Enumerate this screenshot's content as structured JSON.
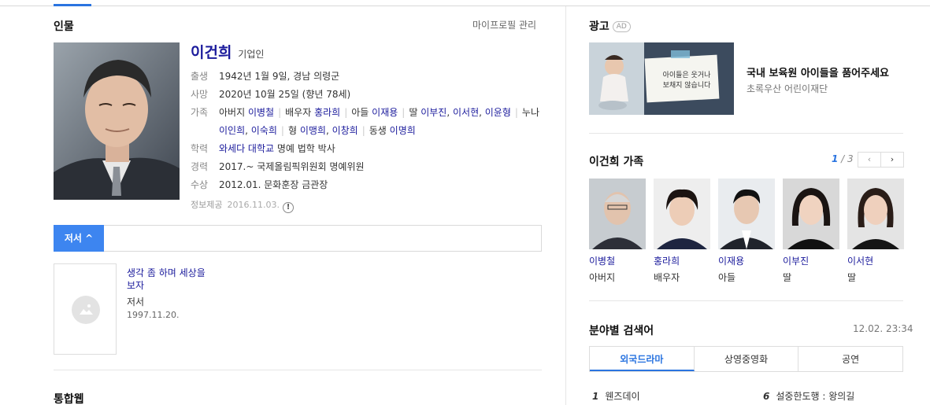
{
  "person": {
    "section_title": "인물",
    "manage_link": "마이프로필 관리",
    "name": "이건희",
    "job": "기업인",
    "birth": {
      "label": "출생",
      "value": "1942년 1월 9일, 경남 의령군"
    },
    "death": {
      "label": "사망",
      "value": "2020년 10월 25일 (향년 78세)"
    },
    "family": {
      "label": "가족",
      "father_rel": "아버지",
      "father": "이병철",
      "spouse_rel": "배우자",
      "spouse": "홍라희",
      "son_rel": "아들",
      "son": "이재용",
      "daughter_rel": "딸",
      "daughter1": "이부진",
      "daughter2": "이서현",
      "daughter3": "이윤형",
      "sister_rel": "누나",
      "sister1": "이인희",
      "sister2": "이숙희",
      "brother_rel": "형",
      "brother1": "이맹희",
      "brother2": "이창희",
      "younger_rel": "동생",
      "younger": "이명희"
    },
    "education": {
      "label": "학력",
      "school": "와세다 대학교",
      "detail": " 명예 법학 박사"
    },
    "career": {
      "label": "경력",
      "value": "2017.~ 국제올림픽위원회 명예위원"
    },
    "award": {
      "label": "수상",
      "value": "2012.01. 문화훈장 금관장"
    },
    "source_label": "정보제공",
    "source_date": "2016.11.03.",
    "excl": "!"
  },
  "works": {
    "tab_label": "저서 ^",
    "book_title": "생각 좀 하며 세상을 보자",
    "book_type": "저서",
    "book_date": "1997.11.20."
  },
  "next_section": "통합웹",
  "ad": {
    "section_title": "광고",
    "badge": "AD",
    "title": "국내 보육원 아이들을 품어주세요",
    "sponsor": "초록우산 어린이재단",
    "sign_line1": "아이들은 웃거나",
    "sign_line2": "보채지 않습니다"
  },
  "family_panel": {
    "title": "이건희 가족",
    "page_current": "1",
    "page_total": " / 3",
    "prev": "‹",
    "next": "›",
    "members": [
      {
        "name": "이병철",
        "relation": "아버지"
      },
      {
        "name": "홍라희",
        "relation": "배우자"
      },
      {
        "name": "이재용",
        "relation": "아들"
      },
      {
        "name": "이부진",
        "relation": "딸"
      },
      {
        "name": "이서현",
        "relation": "딸"
      }
    ]
  },
  "field_search": {
    "title": "분야별 검색어",
    "time": "12.02. 23:34",
    "tabs": [
      "외국드라마",
      "상영중영화",
      "공연"
    ],
    "ranks": [
      {
        "num": "1",
        "text": "웬즈데이"
      },
      {
        "num": "6",
        "text": "설중한도행 : 왕의길"
      }
    ]
  },
  "colors": {
    "accent": "#2a74e0",
    "link": "#1b1b9c"
  }
}
